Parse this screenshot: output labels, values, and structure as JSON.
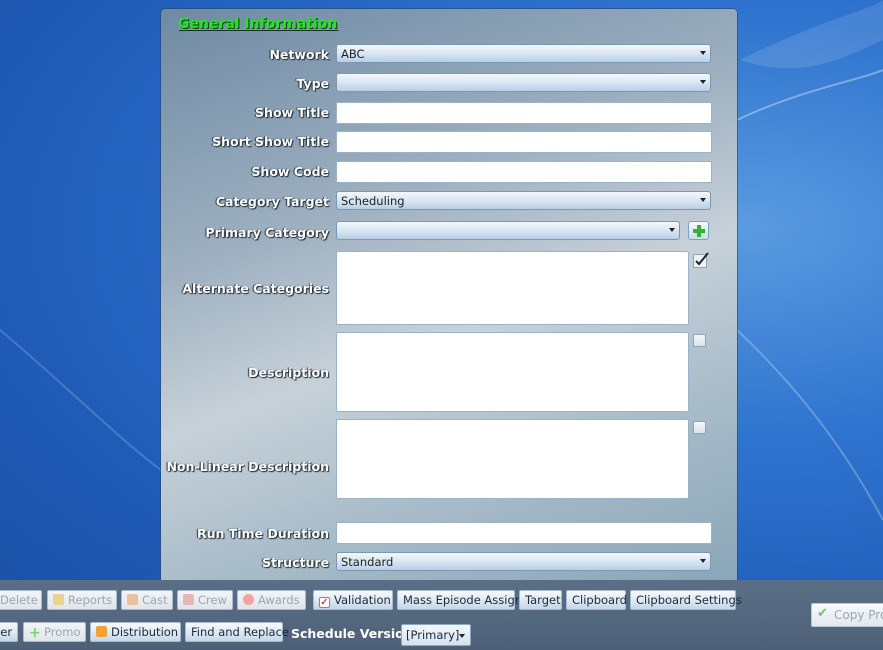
{
  "section_title": "General Information",
  "fields": {
    "network": {
      "label": "Network",
      "value": "ABC"
    },
    "type": {
      "label": "Type",
      "value": ""
    },
    "show_title": {
      "label": "Show Title",
      "value": ""
    },
    "short_show_title": {
      "label": "Short Show Title",
      "value": ""
    },
    "show_code": {
      "label": "Show Code",
      "value": ""
    },
    "category_target": {
      "label": "Category Target",
      "value": "Scheduling"
    },
    "primary_category": {
      "label": "Primary Category",
      "value": ""
    },
    "alternate_categories": {
      "label": "Alternate Categories",
      "checked": true
    },
    "description": {
      "label": "Description",
      "checked": false
    },
    "non_linear_description": {
      "label": "Non-Linear Description",
      "checked": false
    },
    "run_time_duration": {
      "label": "Run Time Duration",
      "value": ""
    },
    "structure": {
      "label": "Structure",
      "value": "Standard"
    }
  },
  "toolbar": {
    "row1": [
      {
        "label": "Delete",
        "enabled": false
      },
      {
        "label": "Reports",
        "enabled": false
      },
      {
        "label": "Cast",
        "enabled": false
      },
      {
        "label": "Crew",
        "enabled": false
      },
      {
        "label": "Awards",
        "enabled": false
      },
      {
        "label": "Validation",
        "enabled": true
      },
      {
        "label": "Mass Episode Assign",
        "enabled": true
      },
      {
        "label": "Target",
        "enabled": true
      },
      {
        "label": "Clipboard",
        "enabled": true
      },
      {
        "label": "Clipboard Settings",
        "enabled": true
      }
    ],
    "row2": [
      {
        "label": "der",
        "enabled": true
      },
      {
        "label": "Promo",
        "enabled": false
      },
      {
        "label": "Distribution",
        "enabled": true
      },
      {
        "label": "Find and Replace",
        "enabled": true
      }
    ],
    "schedule_version_label": "Schedule Version:",
    "schedule_version_value": "[Primary]",
    "copy_label": "Copy Pro"
  },
  "colors": {
    "section_title": "#1ee81e",
    "desktop_blue": "#2f74cf"
  },
  "icons": [
    "add-icon",
    "checkmark-icon",
    "validation-check-icon",
    "reports-icon",
    "cast-icon",
    "crew-icon",
    "awards-icon",
    "promo-icon",
    "distribution-icon",
    "copy-check-icon"
  ]
}
